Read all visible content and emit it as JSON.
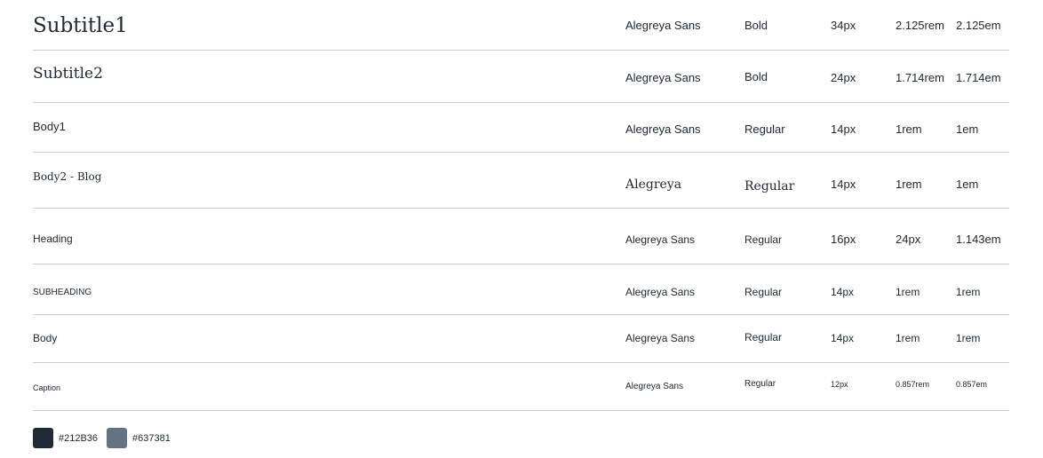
{
  "rows": [
    {
      "name": "Subtitle1",
      "font": "Alegreya Sans",
      "weight": "Bold",
      "size": "34px",
      "rem": "2.125rem",
      "em": "2.125em"
    },
    {
      "name": "Subtitle2",
      "font": "Alegreya Sans",
      "weight": "Bold",
      "size": "24px",
      "rem": "1.714rem",
      "em": "1.714em"
    },
    {
      "name": "Body1",
      "font": "Alegreya Sans",
      "weight": "Regular",
      "size": "14px",
      "rem": "1rem",
      "em": "1em"
    },
    {
      "name": "Body2 - Blog",
      "font": "Alegreya",
      "weight": "Regular",
      "size": "14px",
      "rem": "1rem",
      "em": "1em"
    },
    {
      "name": "Heading",
      "font": "Alegreya Sans",
      "weight": "Regular",
      "size": "16px",
      "rem": "24px",
      "em": "1.143em"
    },
    {
      "name": "SUBHEADING",
      "font": "Alegreya Sans",
      "weight": "Regular",
      "size": "14px",
      "rem": "1rem",
      "em": "1rem"
    },
    {
      "name": "Body",
      "font": "Alegreya Sans",
      "weight": "Regular",
      "size": "14px",
      "rem": "1rem",
      "em": "1rem"
    },
    {
      "name": "Caption",
      "font": "Alegreya Sans",
      "weight": "Regular",
      "size": "12px",
      "rem": "0.857rem",
      "em": "0.857em"
    }
  ],
  "swatches": [
    {
      "hex": "#212B36",
      "color": "#212B36"
    },
    {
      "hex": "#637381",
      "color": "#637381"
    }
  ]
}
